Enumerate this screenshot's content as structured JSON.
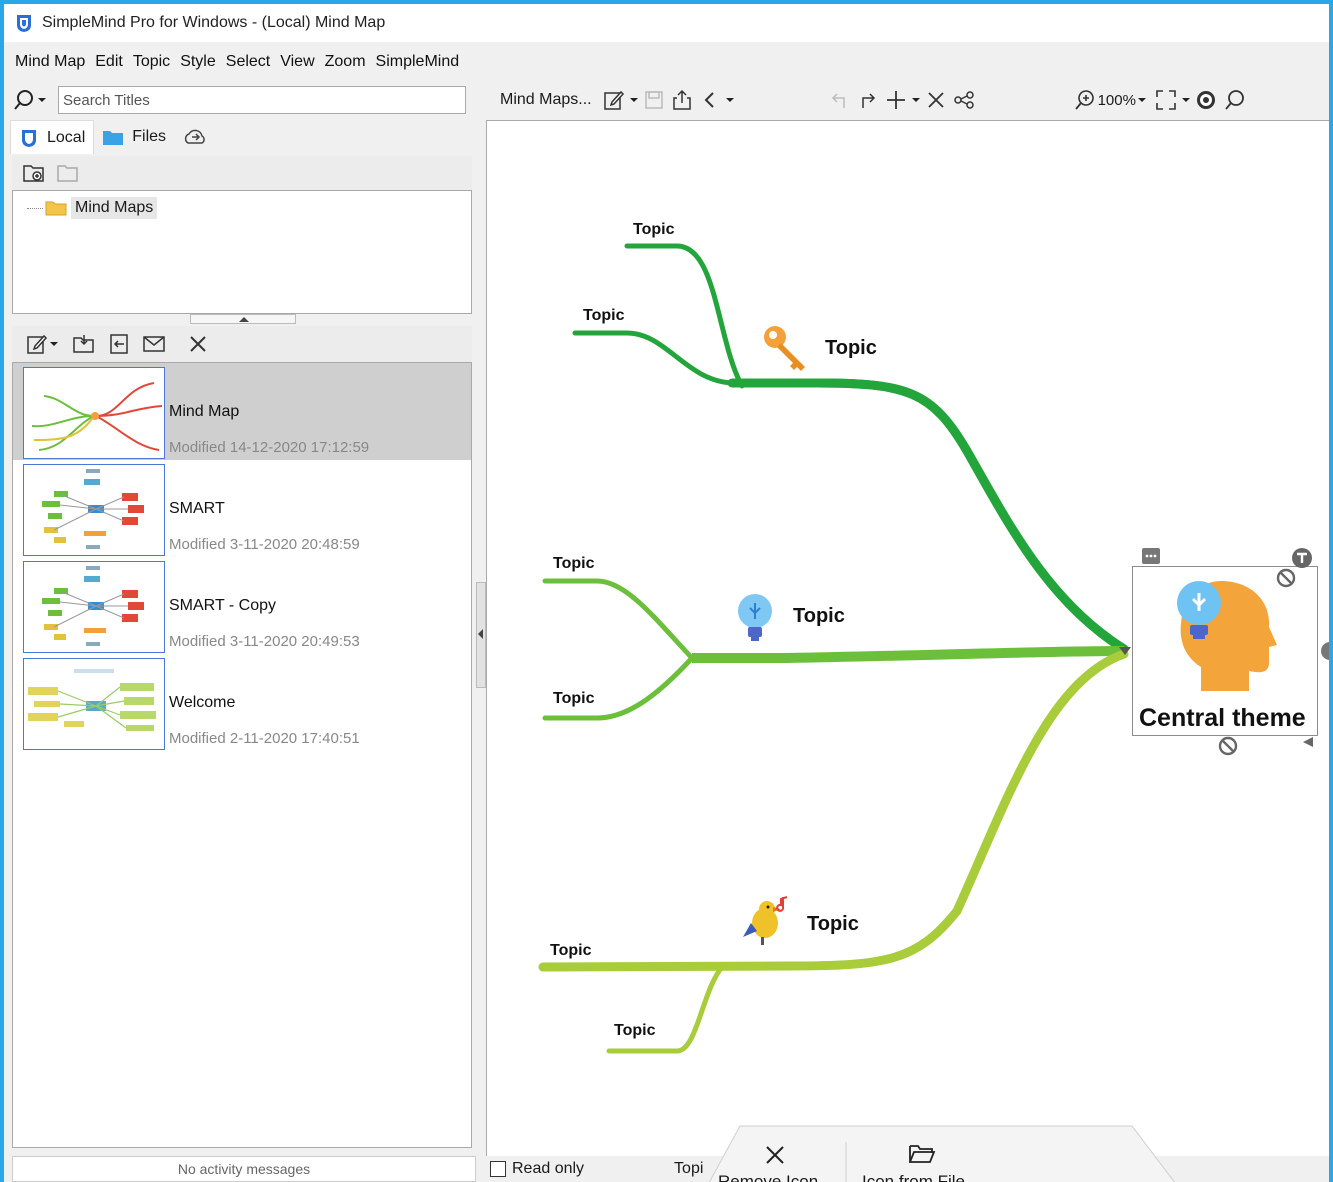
{
  "window": {
    "title": "SimpleMind Pro for Windows - (Local) Mind Map"
  },
  "menu": [
    "Mind Map",
    "Edit",
    "Topic",
    "Style",
    "Select",
    "View",
    "Zoom",
    "SimpleMind"
  ],
  "search": {
    "placeholder": "Search Titles",
    "value": ""
  },
  "left_tabs": [
    {
      "label": "Local",
      "icon": "local-storage-icon",
      "active": true
    },
    {
      "label": "Files",
      "icon": "files-icon",
      "active": false
    },
    {
      "label": "",
      "icon": "cloud-sync-icon",
      "active": false
    }
  ],
  "folders": [
    {
      "label": "Mind Maps",
      "icon": "folder-icon"
    }
  ],
  "documents": [
    {
      "name": "Mind Map",
      "modified": "Modified 14-12-2020 17:12:59",
      "selected": true
    },
    {
      "name": "SMART",
      "modified": "Modified 3-11-2020 20:48:59",
      "selected": false
    },
    {
      "name": "SMART - Copy",
      "modified": "Modified 3-11-2020 20:49:53",
      "selected": false
    },
    {
      "name": "Welcome",
      "modified": "Modified 2-11-2020 17:40:51",
      "selected": false
    }
  ],
  "activity": {
    "message": "No activity messages"
  },
  "map_toolbar": {
    "breadcrumb": "Mind Maps...",
    "zoom": "100%"
  },
  "mind_map": {
    "central": "Central theme",
    "topics": {
      "top_main": "Topic",
      "top_child_1": "Topic",
      "top_child_2": "Topic",
      "mid_main": "Topic",
      "mid_child_1": "Topic",
      "mid_child_2": "Topic",
      "bottom_main": "Topic",
      "bottom_child_1": "Topic",
      "bottom_child_2": "Topic"
    },
    "icons": {
      "top_main": "key-icon",
      "mid_main": "lightbulb-icon",
      "bottom_main": "singing-bird-icon",
      "central": "head-lightbulb-icon"
    },
    "colors": {
      "branch_dark": "#24a53c",
      "branch_mid": "#6cbf3a",
      "branch_light": "#a8cc3a"
    }
  },
  "status": {
    "read_only_label": "Read only",
    "topic_truncated": "Topi"
  },
  "popup": {
    "remove_icon": "Remove Icon",
    "icon_from_file": "Icon from File"
  },
  "colors": {
    "accent": "#29a7e6",
    "selection": "#cfcfcf"
  }
}
